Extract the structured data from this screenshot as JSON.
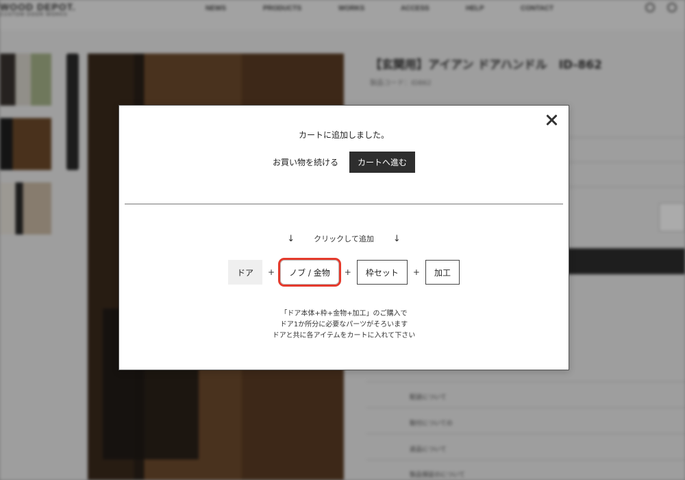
{
  "background": {
    "logo": "WOOD DEPOT.",
    "logo_sub": "CUSTOM DOOR WORKS",
    "nav": [
      "NEWS",
      "PRODUCTS",
      "WORKS",
      "ACCESS",
      "HELP",
      "CONTACT"
    ],
    "product_title": "【玄関用】アイアン ドアハンドル　ID-862",
    "product_sub": "製品コード：ID862",
    "links": [
      "配送について",
      "取付についての",
      "返品について",
      "製品保証のについて"
    ]
  },
  "modal": {
    "added_message": "カートに追加しました。",
    "continue_label": "お買い物を続ける",
    "to_cart_label": "カートへ進む",
    "arrow_left": "↓",
    "click_hint": "クリックして追加",
    "arrow_right": "↓",
    "combo": {
      "door": "ドア",
      "plus1": "+",
      "knob": "ノブ / 金物",
      "plus2": "+",
      "frame": "枠セット",
      "plus3": "+",
      "processing": "加工"
    },
    "note_lines": [
      "「ドア本体+枠+金物+加工」のご購入で",
      "ドア1か所分に必要なパーツがそろいます",
      "ドアと共に各アイテムをカートに入れて下さい"
    ]
  },
  "colors": {
    "highlight": "#e53a2c",
    "cart_button": "#2e2e2e"
  },
  "icons": {
    "close": "close-icon",
    "search": "search-icon",
    "cart": "cart-icon"
  }
}
